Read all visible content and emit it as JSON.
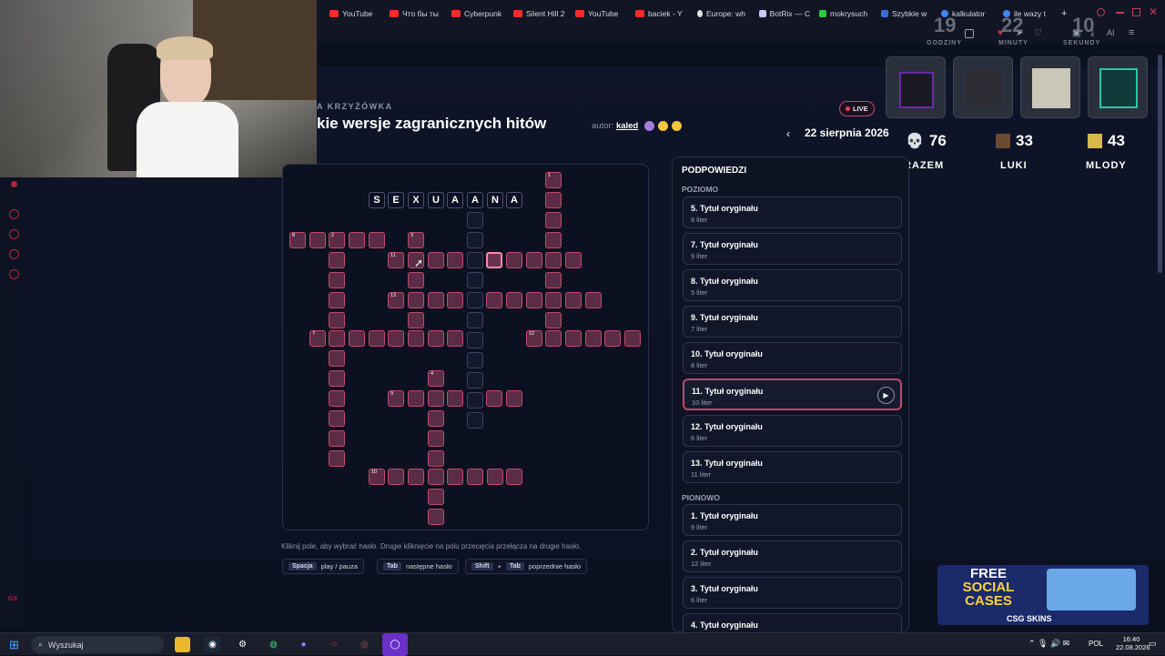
{
  "browser": {
    "tabs": [
      {
        "label": "YouTube",
        "color": "#ff2a2a"
      },
      {
        "label": "Что бы ты",
        "color": "#ff2a2a"
      },
      {
        "label": "Cyberpunk",
        "color": "#ff2a2a"
      },
      {
        "label": "Silent Hill 2",
        "color": "#ff2a2a"
      },
      {
        "label": "YouTube",
        "color": "#ff2a2a"
      },
      {
        "label": "baciek - Y",
        "color": "#ff2a2a"
      },
      {
        "label": "Europe: wh",
        "color": "#e0e0e0"
      },
      {
        "label": "BotRix — C",
        "color": "#c8c8ff"
      },
      {
        "label": "mokrysuch",
        "color": "#2ecc40"
      },
      {
        "label": "Szybkie w",
        "color": "#3a6ad6"
      },
      {
        "label": "kalkulator",
        "color": "#4285f4"
      },
      {
        "label": "ile wazy t",
        "color": "#4285f4"
      }
    ],
    "new_tab": "+"
  },
  "timer": {
    "hours": "19",
    "hours_label": "GODZINY",
    "minutes": "22",
    "minutes_label": "MINUTY",
    "seconds": "10",
    "seconds_label": "SEKUNDY"
  },
  "header": {
    "subtitle": "A KRZYŻÓWKA",
    "title": "kie wersje zagranicznych hitów",
    "author_label": "autor:",
    "author_name": "kaled",
    "live": "LIVE",
    "date": "22 sierpnia 2026",
    "prev_icon": "chevron-left-icon"
  },
  "scores": [
    {
      "icon": "skull-icon",
      "value": "76",
      "label": "RAZEM"
    },
    {
      "icon": "player-head-icon",
      "value": "33",
      "label": "LUKI"
    },
    {
      "icon": "player-head-icon",
      "value": "43",
      "label": "MLODY"
    }
  ],
  "crossword": {
    "letters": [
      "S",
      "E",
      "X",
      "U",
      "A",
      "A",
      "N",
      "A"
    ]
  },
  "instructions": {
    "text": "Kliknij pole, aby wybrać hasło. Drugie kliknięcie na polu przecięcia przełącza na drugie hasło.",
    "keys": [
      {
        "k1": "Spacja",
        "k2": "",
        "desc": "play / pauza"
      },
      {
        "k1": "Tab",
        "k2": "",
        "desc": "następne hasło"
      },
      {
        "k1": "Shift",
        "plus": "+",
        "k2": "Tab",
        "desc": "poprzednie hasło"
      }
    ]
  },
  "clues": {
    "heading": "PODPOWIEDZI",
    "across_label": "POZIOMO",
    "down_label": "PIONOWO",
    "across": [
      {
        "title": "5. Tytuł oryginału",
        "len": "8 liter"
      },
      {
        "title": "7. Tytuł oryginału",
        "len": "9 liter"
      },
      {
        "title": "8. Tytuł oryginału",
        "len": "5 liter"
      },
      {
        "title": "9. Tytuł oryginału",
        "len": "7 liter"
      },
      {
        "title": "10. Tytuł oryginału",
        "len": "8 liter"
      },
      {
        "title": "11. Tytuł oryginału",
        "len": "10 liter"
      },
      {
        "title": "12. Tytuł oryginału",
        "len": "6 liter"
      },
      {
        "title": "13. Tytuł oryginału",
        "len": "11 liter"
      }
    ],
    "down": [
      {
        "title": "1. Tytuł oryginału",
        "len": "9 liter"
      },
      {
        "title": "2. Tytuł oryginału",
        "len": "12 liter"
      },
      {
        "title": "3. Tytuł oryginału",
        "len": "6 liter"
      },
      {
        "title": "4. Tytuł oryginału",
        "len": ""
      }
    ]
  },
  "ad": {
    "line1": "FREE",
    "line2": "SOCIAL",
    "line3": "CASES",
    "brand": "CSG SKINS"
  },
  "taskbar": {
    "search": "Wyszukaj",
    "lang": "POL",
    "time": "16:40",
    "date": "22.08.2026"
  }
}
